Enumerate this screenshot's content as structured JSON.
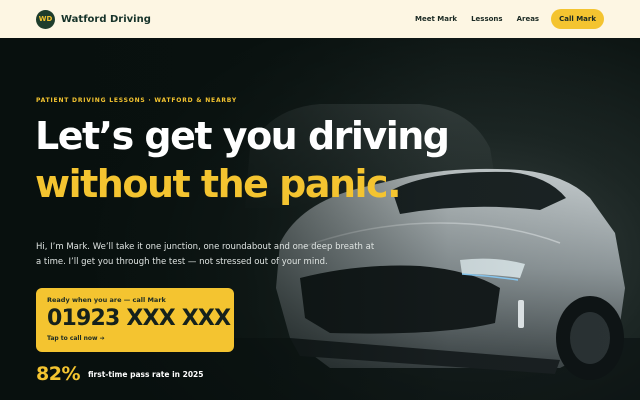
{
  "nav": {
    "logo_initials": "WD",
    "brand": "Watford Driving",
    "links": [
      "Meet Mark",
      "Lessons",
      "Areas"
    ],
    "cta": "Call Mark"
  },
  "hero": {
    "eyebrow": "PATIENT DRIVING LESSONS · WATFORD & NEARBY",
    "headline_line1": "Let’s get you driving",
    "headline_line2": "without the panic.",
    "intro": "Hi, I’m Mark. We’ll take it one junction, one roundabout and one deep breath at a time. I’ll get you through the test — not stressed out of your mind.",
    "call_card": {
      "kicker": "Ready when you are — call Mark",
      "number": "01923 XXX XXX",
      "tap": "Tap to call now ➔"
    },
    "stat": {
      "value": "82%",
      "label": "first-time pass rate in 2025"
    }
  },
  "colors": {
    "accent": "#f4c430",
    "brand_dark": "#1e3d2c",
    "nav_bg": "#fdf6e3",
    "hero_bg": "#0d1614"
  },
  "icons": {
    "hero_image": "sports-car-photo"
  }
}
